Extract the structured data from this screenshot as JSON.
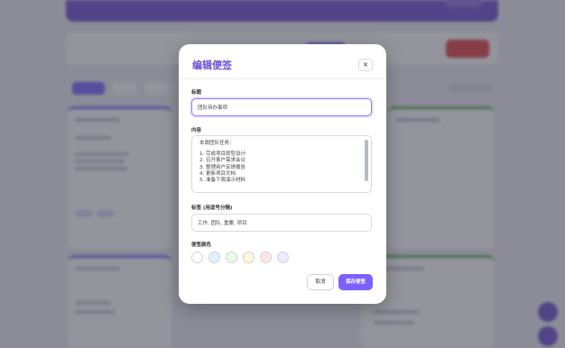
{
  "modal": {
    "title": "编辑便签",
    "close_icon": "×",
    "title_label": "标题",
    "title_value": "团队待办事项",
    "content_label": "内容",
    "content_lines": [
      "本周团队任务：",
      "",
      "1. 完成项目原型设计",
      "2. 召开客户需求会议",
      "3. 整理用户反馈报告",
      "4. 更新项目文档",
      "5. 准备下周演示材料"
    ],
    "tags_label": "标签 (用逗号分隔)",
    "tags_value": "工作, 团队, 重要, 项目",
    "color_label": "便签颜色",
    "colors": [
      "#ffffff",
      "#e3f0ff",
      "#eafbe6",
      "#fff7dd",
      "#ffe6e6",
      "#f1e8ff"
    ],
    "cancel_label": "取消",
    "save_label": "保存便签"
  },
  "accent": "#7b61ff"
}
